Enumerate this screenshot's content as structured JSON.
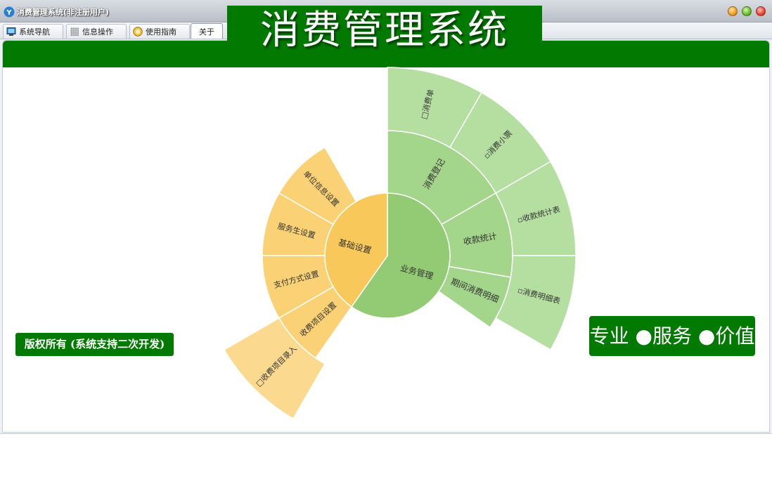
{
  "window": {
    "title": "消费管理系统(非注册用户)"
  },
  "tabs": [
    {
      "label": "系统导航",
      "icon": "monitor-icon"
    },
    {
      "label": "信息操作",
      "icon": "grid-icon"
    },
    {
      "label": "使用指南",
      "icon": "guide-icon"
    },
    {
      "label": "关于",
      "icon": ""
    }
  ],
  "active_tab": "关于",
  "about": {
    "main_title": "消费管理系统",
    "copyright": "版权所有 (系统支持二次开发)",
    "slogan": "专业 ●服务 ●价值"
  },
  "sunburst": {
    "center_left": "基础设置",
    "center_right": "业务管理",
    "outer_left": [
      "单位信息设置",
      "服务生设置",
      "支付方式设置",
      "收费项目设置"
    ],
    "extra_left": "□收费项目录入",
    "outer_right": [
      "消费登记",
      "收款统计",
      "期间消费明细"
    ],
    "extra_right": [
      "□消费单",
      "▫消费小票",
      "▫收款统计表",
      "▫消费明细表"
    ],
    "colors": {
      "center_left": "#f8c85a",
      "outer_left": "#fad275",
      "extra_left": "#fbd98e",
      "center_right": "#93cb74",
      "outer_right": "#a3d58b",
      "extra_right": "#b4dfa1",
      "accent_green": "#027a02"
    }
  }
}
